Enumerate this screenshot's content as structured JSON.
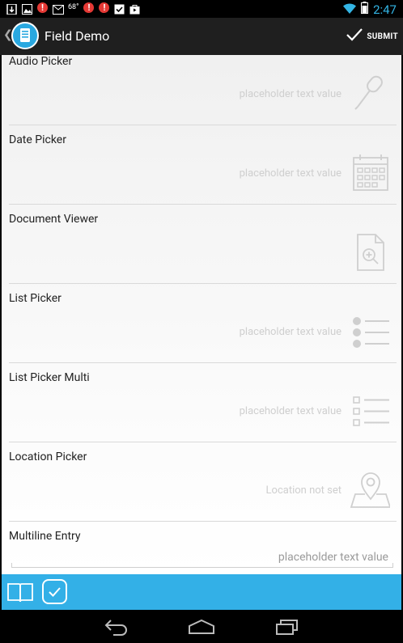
{
  "status_bar": {
    "temperature": "68°",
    "alert_glyph": "!",
    "time": "2:47"
  },
  "action_bar": {
    "title": "Field Demo",
    "submit_label": "SUBMIT"
  },
  "fields": [
    {
      "label": "Audio Picker",
      "value": "placeholder text value",
      "icon": "microphone-icon"
    },
    {
      "label": "Date Picker",
      "value": "placeholder text value",
      "icon": "calendar-icon"
    },
    {
      "label": "Document Viewer",
      "value": "",
      "icon": "document-zoom-icon"
    },
    {
      "label": "List Picker",
      "value": "placeholder text value",
      "icon": "list-bullets-icon"
    },
    {
      "label": "List Picker Multi",
      "value": "placeholder text value",
      "icon": "checkbox-list-icon"
    },
    {
      "label": "Location Picker",
      "value": "Location not set",
      "icon": "map-pin-icon"
    },
    {
      "label": "Multiline Entry",
      "value": "placeholder text value",
      "icon": ""
    }
  ],
  "colors": {
    "accent": "#33b0e7",
    "clock": "#33b5e5",
    "action_bar": "#1f1f1f",
    "alert": "#e53935"
  }
}
